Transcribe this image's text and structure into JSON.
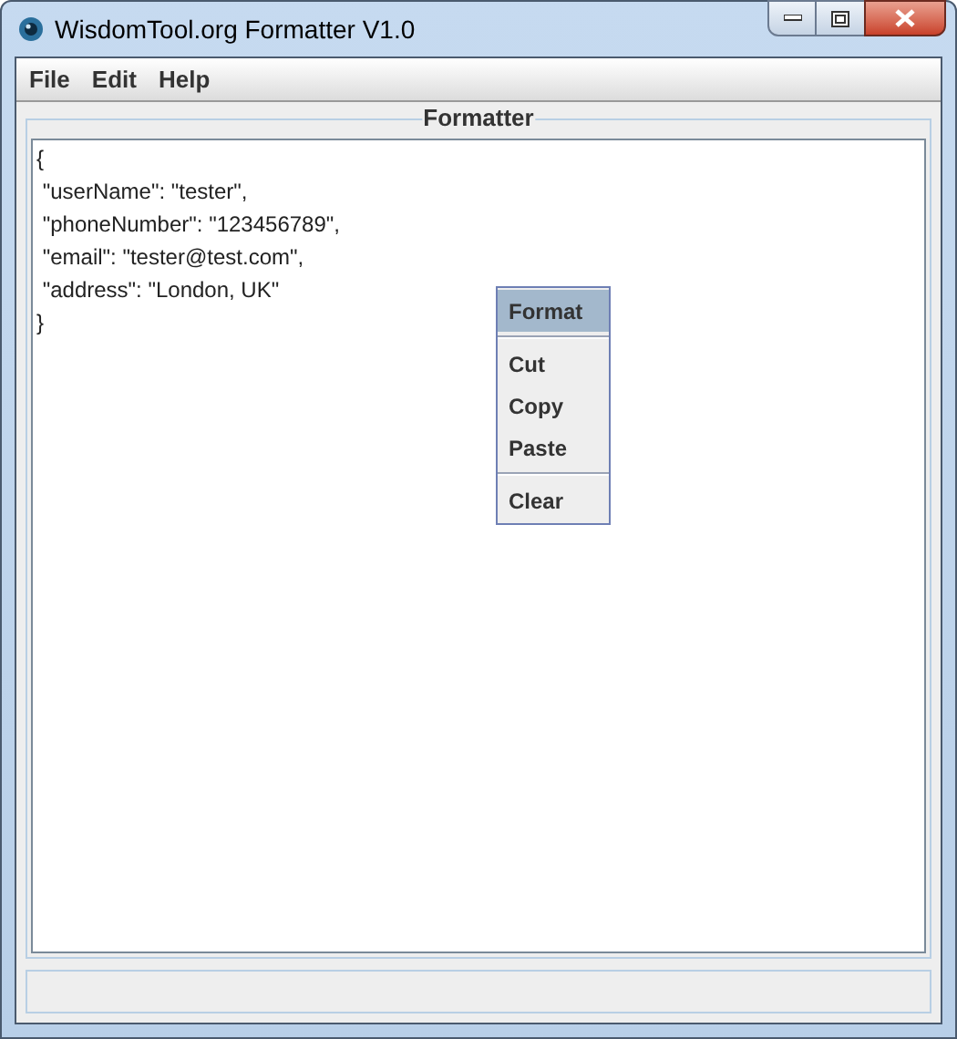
{
  "window": {
    "title": "WisdomTool.org Formatter V1.0"
  },
  "menu_bar": [
    "File",
    "Edit",
    "Help"
  ],
  "panel": {
    "title": "Formatter"
  },
  "editor": {
    "lines": [
      "{",
      " \"userName\": \"tester\",",
      " \"phoneNumber\": \"123456789\",",
      " \"email\": \"tester@test.com\",",
      " \"address\": \"London, UK\"",
      "}"
    ]
  },
  "context_menu": [
    {
      "kind": "item",
      "label": "Format",
      "selected": true
    },
    {
      "kind": "separator"
    },
    {
      "kind": "item",
      "label": "Cut",
      "selected": false
    },
    {
      "kind": "item",
      "label": "Copy",
      "selected": false
    },
    {
      "kind": "item",
      "label": "Paste",
      "selected": false
    },
    {
      "kind": "separator"
    },
    {
      "kind": "item",
      "label": "Clear",
      "selected": false
    }
  ]
}
